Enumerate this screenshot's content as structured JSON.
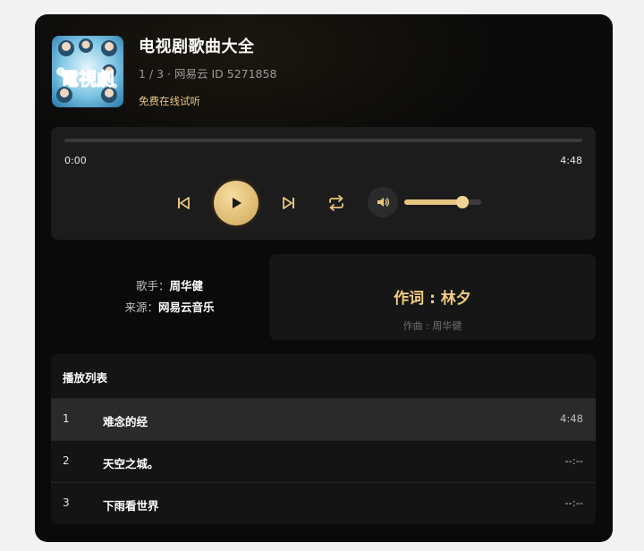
{
  "album": {
    "title": "电视剧歌曲大全",
    "meta": "1 / 3 · 网易云 ID 5271858",
    "free_label": "免费在线试听",
    "cover_text": "電視劇"
  },
  "player": {
    "current_time": "0:00",
    "total_time": "4:48",
    "progress": 0,
    "volume": 0.75,
    "icons": {
      "prev": "skip-previous-icon",
      "play": "play-icon",
      "next": "skip-next-icon",
      "repeat": "repeat-icon",
      "volume": "volume-icon"
    }
  },
  "info": {
    "singer_label": "歌手：",
    "singer": "周华健",
    "source_label": "来源：",
    "source": "网易云音乐"
  },
  "lyrics": {
    "lyricist": "作词 : 林夕",
    "composer": "作曲 : 周华健"
  },
  "playlist": {
    "header": "播放列表",
    "tracks": [
      {
        "num": "1",
        "name": "难念的经",
        "duration": "4:48"
      },
      {
        "num": "2",
        "name": "天空之城。",
        "duration": "--:--"
      },
      {
        "num": "3",
        "name": "下雨看世界",
        "duration": "--:--"
      }
    ]
  },
  "colors": {
    "accent": "#e6c57f",
    "background": "#0a0a0a",
    "panel": "#1c1c1c"
  }
}
